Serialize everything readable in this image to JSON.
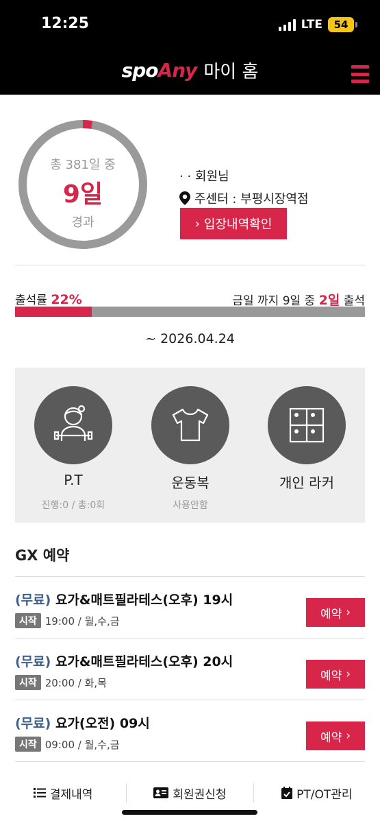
{
  "status": {
    "time": "12:25",
    "network": "LTE",
    "battery": "54"
  },
  "header": {
    "brand_logo_left": "spo",
    "brand_logo_right": "Any",
    "title": "마이 홈"
  },
  "profile": {
    "ring_total": "총 381일 중",
    "ring_days": "9일",
    "ring_elapsed": "경과",
    "ring_fraction": 0.024,
    "user_name": "· ·  회원님",
    "center": "주센터 : 부평시장역점",
    "entry_button": "입장내역확인"
  },
  "attendance": {
    "rate_label": "출석률",
    "rate_value": "22%",
    "rate_fraction": 0.22,
    "summary_prefix": "금일 까지 9일 중",
    "summary_value": "2일",
    "summary_suffix": "출석",
    "expiry": "~ 2026.04.24"
  },
  "services": [
    {
      "label": "P.T",
      "sub": "진행:0 / 총:0회",
      "icon": "trainer-icon"
    },
    {
      "label": "운동복",
      "sub": "사용안함",
      "icon": "shirt-icon"
    },
    {
      "label": "개인 라커",
      "sub": "",
      "icon": "locker-icon"
    }
  ],
  "gx": {
    "title": "GX 예약",
    "items": [
      {
        "free": "(무료)",
        "name": "요가&매트필라테스(오후) 19시",
        "tag": "시작",
        "time": "19:00 / 월,수,금",
        "button": "예약"
      },
      {
        "free": "(무료)",
        "name": "요가&매트필라테스(오후) 20시",
        "tag": "시작",
        "time": "20:00 / 화,목",
        "button": "예약"
      },
      {
        "free": "(무료)",
        "name": "요가(오전) 09시",
        "tag": "시작",
        "time": "09:00 / 월,수,금",
        "button": "예약"
      }
    ]
  },
  "bottom_nav": [
    {
      "label": "결제내역",
      "icon": "list-icon"
    },
    {
      "label": "회원권신청",
      "icon": "id-card-icon"
    },
    {
      "label": "PT/OT관리",
      "icon": "calendar-check-icon"
    }
  ],
  "colors": {
    "accent": "#d8254a",
    "free": "#3d5f8a",
    "ring_gray": "#9a9a9a"
  }
}
